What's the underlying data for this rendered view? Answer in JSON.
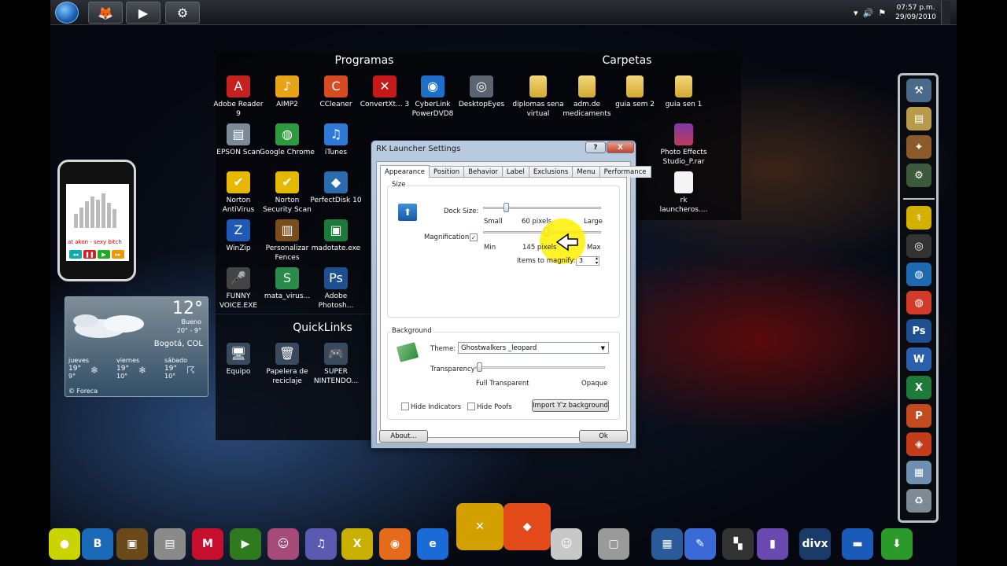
{
  "taskbar": {
    "tasks": [
      {
        "name": "firefox",
        "glyph": "🦊"
      },
      {
        "name": "media",
        "glyph": "▶"
      },
      {
        "name": "settings",
        "glyph": "⚙"
      }
    ],
    "clock": {
      "time": "07:57 p.m.",
      "date": "29/09/2010"
    }
  },
  "fence_programas": {
    "title": "Programas",
    "items": [
      {
        "label": "Adobe Reader 9",
        "glyph": "A",
        "color": "#c5221f"
      },
      {
        "label": "AIMP2",
        "glyph": "♪",
        "color": "#e8a317"
      },
      {
        "label": "CCleaner",
        "glyph": "C",
        "color": "#d84a22"
      },
      {
        "label": "ConvertXt... 3",
        "glyph": "✕",
        "color": "#c61a1a"
      },
      {
        "label": "CyberLink PowerDVD8",
        "glyph": "◉",
        "color": "#1f6ec9"
      },
      {
        "label": "DesktopEyes",
        "glyph": "◎",
        "color": "#5b6470"
      },
      {
        "label": "EPSON Scan",
        "glyph": "▤",
        "color": "#7a8a99"
      },
      {
        "label": "Google Chrome",
        "glyph": "◍",
        "color": "#2d9a3f"
      },
      {
        "label": "iTunes",
        "glyph": "♫",
        "color": "#2f79d8"
      },
      {
        "label": "Norton AntiVirus",
        "glyph": "✔",
        "color": "#e6b800"
      },
      {
        "label": "Norton Security Scan",
        "glyph": "✔",
        "color": "#e6b800"
      },
      {
        "label": "PerfectDisk 10",
        "glyph": "◆",
        "color": "#2b6cb0"
      },
      {
        "label": "WinZip",
        "glyph": "Z",
        "color": "#1e59b8"
      },
      {
        "label": "Personalizar Fences",
        "glyph": "▥",
        "color": "#7a4d1f"
      },
      {
        "label": "madotate.exe",
        "glyph": "▣",
        "color": "#1a7a3a"
      },
      {
        "label": "FUNNY VOICE.EXE",
        "glyph": "🎤",
        "color": "#444"
      },
      {
        "label": "mata_virus...",
        "glyph": "S",
        "color": "#2a8a4a"
      },
      {
        "label": "Adobe Photosh...",
        "glyph": "Ps",
        "color": "#1d4f91"
      }
    ]
  },
  "fence_carpetas": {
    "title": "Carpetas",
    "items": [
      {
        "label": "diplomas sena virtual"
      },
      {
        "label": "adm.de medicaments"
      },
      {
        "label": "guia sem 2"
      },
      {
        "label": "guia sen 1"
      },
      {
        "label": "Photo Effects Studio_P.rar"
      },
      {
        "label": "rk launcheros...."
      }
    ]
  },
  "fence_quicklinks": {
    "title": "QuickLinks",
    "items": [
      {
        "label": "Equipo",
        "glyph": "🖥"
      },
      {
        "label": "Papelera de reciclaje",
        "glyph": "🗑"
      },
      {
        "label": "SUPER NINTENDO...",
        "glyph": "🎮"
      }
    ]
  },
  "phone_gadget": {
    "song": "at akon - sexy bitch"
  },
  "weather": {
    "temp": "12°",
    "condition": "Bueno",
    "hilo": "20° - 9°",
    "city": "Bogotá, COL",
    "days": [
      {
        "day": "jueves",
        "hi": "19°",
        "lo": "9°"
      },
      {
        "day": "viernes",
        "hi": "19°",
        "lo": "10°"
      },
      {
        "day": "sábado",
        "hi": "19°",
        "lo": "10°"
      }
    ],
    "provider": "© Foreca"
  },
  "dialog": {
    "title": "RK Launcher Settings",
    "help": "?",
    "close": "X",
    "tabs": [
      "Appearance",
      "Position",
      "Behavior",
      "Label",
      "Exclusions",
      "Menu",
      "Performance"
    ],
    "size_group": "Size",
    "dock_size_label": "Dock Size:",
    "dock_small": "Small",
    "dock_value": "60 pixels",
    "dock_large": "Large",
    "magnification_label": "Magnification:",
    "mag_min": "Min",
    "mag_value": "145 pixels",
    "mag_max": "Max",
    "items_to_magnify_label": "Items to magnify:",
    "items_to_magnify": "3",
    "background_group": "Background",
    "theme_label": "Theme:",
    "theme_value": "Ghostwalkers _leopard",
    "transparency_label": "Transparency",
    "full_transparent": "Full Transparent",
    "opaque": "Opaque",
    "hide_indicators": "Hide Indicators",
    "hide_poofs": "Hide Poofs",
    "import_button": "Import Y'z background",
    "about_button": "About...",
    "ok_button": "Ok"
  },
  "rk_vertical": [
    {
      "name": "tools-icon",
      "glyph": "⚒",
      "color": "#4a6a8a"
    },
    {
      "name": "notes-icon",
      "glyph": "▤",
      "color": "#b59b4a"
    },
    {
      "name": "character-icon",
      "glyph": "✦",
      "color": "#8a5a2a"
    },
    {
      "name": "robot-icon",
      "glyph": "⚙",
      "color": "#3d5a3d"
    },
    {
      "name": "stethoscope-icon",
      "glyph": "⚕",
      "color": "#d4b000"
    },
    {
      "name": "film-reel-icon",
      "glyph": "◎",
      "color": "#333"
    },
    {
      "name": "globe-icon",
      "glyph": "◍",
      "color": "#1e6ab0"
    },
    {
      "name": "chrome-icon",
      "glyph": "◍",
      "color": "#d23a2a"
    },
    {
      "name": "photoshop-icon",
      "glyph": "Ps",
      "color": "#1d4f91"
    },
    {
      "name": "word-icon",
      "glyph": "W",
      "color": "#2a5fae"
    },
    {
      "name": "excel-icon",
      "glyph": "X",
      "color": "#1f7a3a"
    },
    {
      "name": "powerpoint-icon",
      "glyph": "P",
      "color": "#c24a1e"
    },
    {
      "name": "office-icon",
      "glyph": "◈",
      "color": "#c43c1a"
    },
    {
      "name": "calculator-icon",
      "glyph": "▦",
      "color": "#6f8fb0"
    },
    {
      "name": "recycle-bin-icon",
      "glyph": "♻",
      "color": "#7d8a96"
    }
  ],
  "dock": [
    {
      "name": "tennis-ball-icon",
      "glyph": "●",
      "color": "#c9d400"
    },
    {
      "name": "letter-b-icon",
      "glyph": "B",
      "color": "#1a6ab8"
    },
    {
      "name": "photo-icon",
      "glyph": "▣",
      "color": "#6a4a1a"
    },
    {
      "name": "scanner-icon",
      "glyph": "▤",
      "color": "#8a8a8a"
    },
    {
      "name": "mcafee-icon",
      "glyph": "M",
      "color": "#c8102e"
    },
    {
      "name": "media-player-icon",
      "glyph": "▶",
      "color": "#2f7a1f"
    },
    {
      "name": "pig-icon",
      "glyph": "☺",
      "color": "#a64a7a"
    },
    {
      "name": "itunes-icon",
      "glyph": "♫",
      "color": "#5a5ab0"
    },
    {
      "name": "xbox-icon",
      "glyph": "X",
      "color": "#c9b000"
    },
    {
      "name": "firefox-icon",
      "glyph": "◉",
      "color": "#e56a1a"
    },
    {
      "name": "ie-icon",
      "glyph": "e",
      "color": "#1a6ad8"
    },
    {
      "name": "xmarks-icon",
      "glyph": "✕",
      "color": "#d4a000"
    },
    {
      "name": "app-icon",
      "glyph": "◆",
      "color": "#e24a1a"
    },
    {
      "name": "messenger-icon",
      "glyph": "☺",
      "color": "#c8c8c8"
    },
    {
      "name": "box-icon",
      "glyph": "▢",
      "color": "#9a9a9a"
    },
    {
      "name": "grid-icon",
      "glyph": "▦",
      "color": "#2a5a9a"
    },
    {
      "name": "pencil-icon",
      "glyph": "✎",
      "color": "#3a6ad8"
    },
    {
      "name": "clapper-icon",
      "glyph": "▚",
      "color": "#333"
    },
    {
      "name": "sidebar-icon",
      "glyph": "▮",
      "color": "#6a4ab0"
    },
    {
      "name": "divx-icon",
      "glyph": "divx",
      "color": "#1a3a6a"
    },
    {
      "name": "car-icon",
      "glyph": "▬",
      "color": "#1a5ab8"
    },
    {
      "name": "download-icon",
      "glyph": "⬇",
      "color": "#2a9a2a"
    }
  ]
}
